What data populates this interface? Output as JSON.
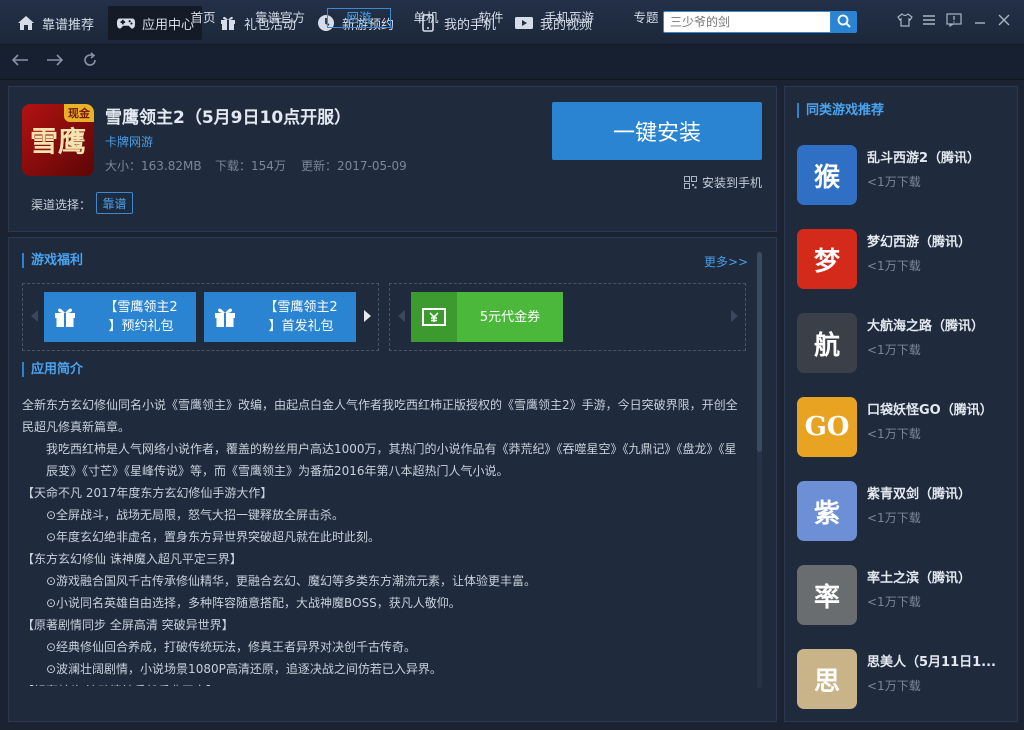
{
  "nav": {
    "tabs": [
      {
        "label": "靠谱推荐",
        "icon": "home-icon"
      },
      {
        "label": "应用中心",
        "icon": "gamepad-icon"
      },
      {
        "label": "礼包活动",
        "icon": "gift-icon"
      },
      {
        "label": "新游预约",
        "icon": "clock-icon"
      },
      {
        "label": "我的手机",
        "icon": "phone-icon"
      },
      {
        "label": "我的视频",
        "icon": "video-icon"
      }
    ],
    "search_placeholder": "三少爷的剑"
  },
  "subnav": {
    "tabs": [
      "首页",
      "靠谱官方",
      "网游",
      "单机",
      "软件",
      "手机页游",
      "专题"
    ]
  },
  "app": {
    "title": "雪鹰领主2（5月9日10点开服）",
    "type": "卡牌网游",
    "size": "大小：163.82MB",
    "downloads": "下载：154万",
    "updated": "更新：2017-05-09",
    "icon_text": "雪鹰",
    "icon_badge": "现金",
    "install_label": "一键安装",
    "install_phone_label": "安装到手机",
    "channel_label": "渠道选择：",
    "channel_value": "靠谱"
  },
  "welfare": {
    "heading": "游戏福利",
    "more": "更多>>",
    "gifts": [
      {
        "line1": "【雪鹰领主2",
        "line2": "】预约礼包"
      },
      {
        "line1": "【雪鹰领主2",
        "line2": "】首发礼包"
      }
    ],
    "coupon": "5元代金券"
  },
  "intro": {
    "heading": "应用简介",
    "lines": [
      {
        "text": "全新东方玄幻修仙同名小说《雪鹰领主》改编，由起点白金人气作者我吃西红柿正版授权的《雪鹰领主2》手游，今日突破界限，开创全民超凡修真新篇章。",
        "cls": ""
      },
      {
        "text": "我吃西红柿是人气网络小说作者，覆盖的粉丝用户高达1000万，其热门的小说作品有《莽荒纪》《吞噬星空》《九鼎记》《盘龙》《星辰变》《寸芒》《星峰传说》等，而《雪鹰领主》为番茄2016年第八本超热门人气小说。",
        "cls": "ind1"
      },
      {
        "text": "【天命不凡 2017年度东方玄幻修仙手游大作】",
        "cls": ""
      },
      {
        "text": "⊙全屏战斗，战场无局限，怒气大招一键释放全屏击杀。",
        "cls": "ind2"
      },
      {
        "text": "⊙年度玄幻绝非虚名，置身东方异世界突破超凡就在此时此刻。",
        "cls": "ind2"
      },
      {
        "text": "【东方玄幻修仙 诛神魔入超凡平定三界】",
        "cls": ""
      },
      {
        "text": "⊙游戏融合国风千古传承修仙精华，更融合玄幻、魔幻等多类东方潮流元素，让体验更丰富。",
        "cls": "ind2"
      },
      {
        "text": "⊙小说同名英雄自由选择，多种阵容随意搭配，大战神魔BOSS，获凡人敬仰。",
        "cls": "ind2"
      },
      {
        "text": "【原著剧情同步 全屏高清 突破异世界】",
        "cls": ""
      },
      {
        "text": "⊙经典修仙回合养成，打破传统玩法，修真王者异界对决创千古传奇。",
        "cls": "ind2"
      },
      {
        "text": "⊙波澜壮阔剧情，小说场景1080P高清还原，追逐决战之间仿若已入异界。",
        "cls": "ind2"
      },
      {
        "text": "【轻奢蛙头 流动情神兵战乐典天宫】",
        "cls": ""
      }
    ]
  },
  "recommend": {
    "heading": "同类游戏推荐",
    "items": [
      {
        "name": "乱斗西游2（腾讯）",
        "dl": "<1万下载",
        "icon_text": "猴",
        "color": "#2f6fc4"
      },
      {
        "name": "梦幻西游（腾讯）",
        "dl": "<1万下载",
        "icon_text": "梦",
        "color": "#d42a1c"
      },
      {
        "name": "大航海之路（腾讯）",
        "dl": "<1万下载",
        "icon_text": "航",
        "color": "#3b3f48"
      },
      {
        "name": "口袋妖怪GO（腾讯）",
        "dl": "<1万下载",
        "icon_text": "GO",
        "color": "#e9a322"
      },
      {
        "name": "紫青双剑（腾讯）",
        "dl": "<1万下载",
        "icon_text": "紫",
        "color": "#6d8fd6"
      },
      {
        "name": "率土之滨（腾讯）",
        "dl": "<1万下载",
        "icon_text": "率",
        "color": "#6a6d70"
      },
      {
        "name": "思美人（5月11日1...",
        "dl": "<1万下载",
        "icon_text": "思",
        "color": "#c9b48a"
      }
    ]
  }
}
